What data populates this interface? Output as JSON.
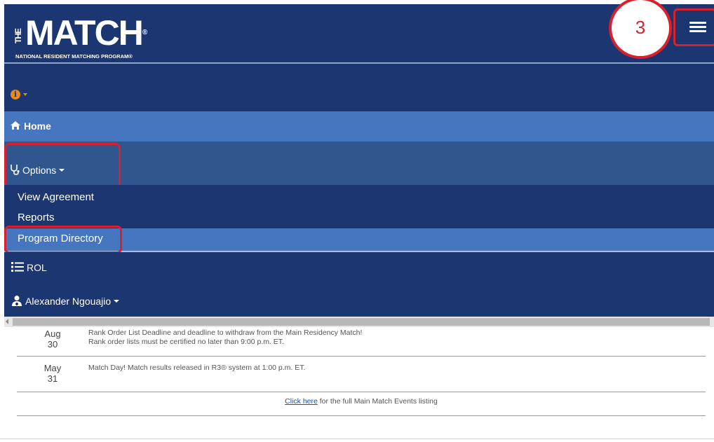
{
  "brand": {
    "the": "THE",
    "logo": "MATCH",
    "registered": "®",
    "subtitle": "NATIONAL RESIDENT MATCHING PROGRAM®"
  },
  "step_callout": "3",
  "menu": {
    "info_icon": "info-icon",
    "home": "Home",
    "options": "Options",
    "options_items": [
      "View Agreement",
      "Reports",
      "Program Directory"
    ],
    "rol": "ROL",
    "user": "Alexander Ngouajio"
  },
  "events": [
    {
      "month": "Aug",
      "day": "30",
      "line1": "Rank Order List Deadline and deadline to withdraw from the Main Residency Match!",
      "line2": "Rank order lists must be certified no later than 9:00 p.m. ET."
    },
    {
      "month": "May",
      "day": "31",
      "line1": "Match Day! Match results released in R3® system at 1:00 p.m. ET.",
      "line2": ""
    }
  ],
  "footer": {
    "link": "Click here",
    "text": " for the full Main Match Events listing"
  },
  "colors": {
    "navy": "#1b3670",
    "highlight": "#4676bf",
    "callout_red": "#d7212e",
    "info_orange": "#e8891b"
  }
}
